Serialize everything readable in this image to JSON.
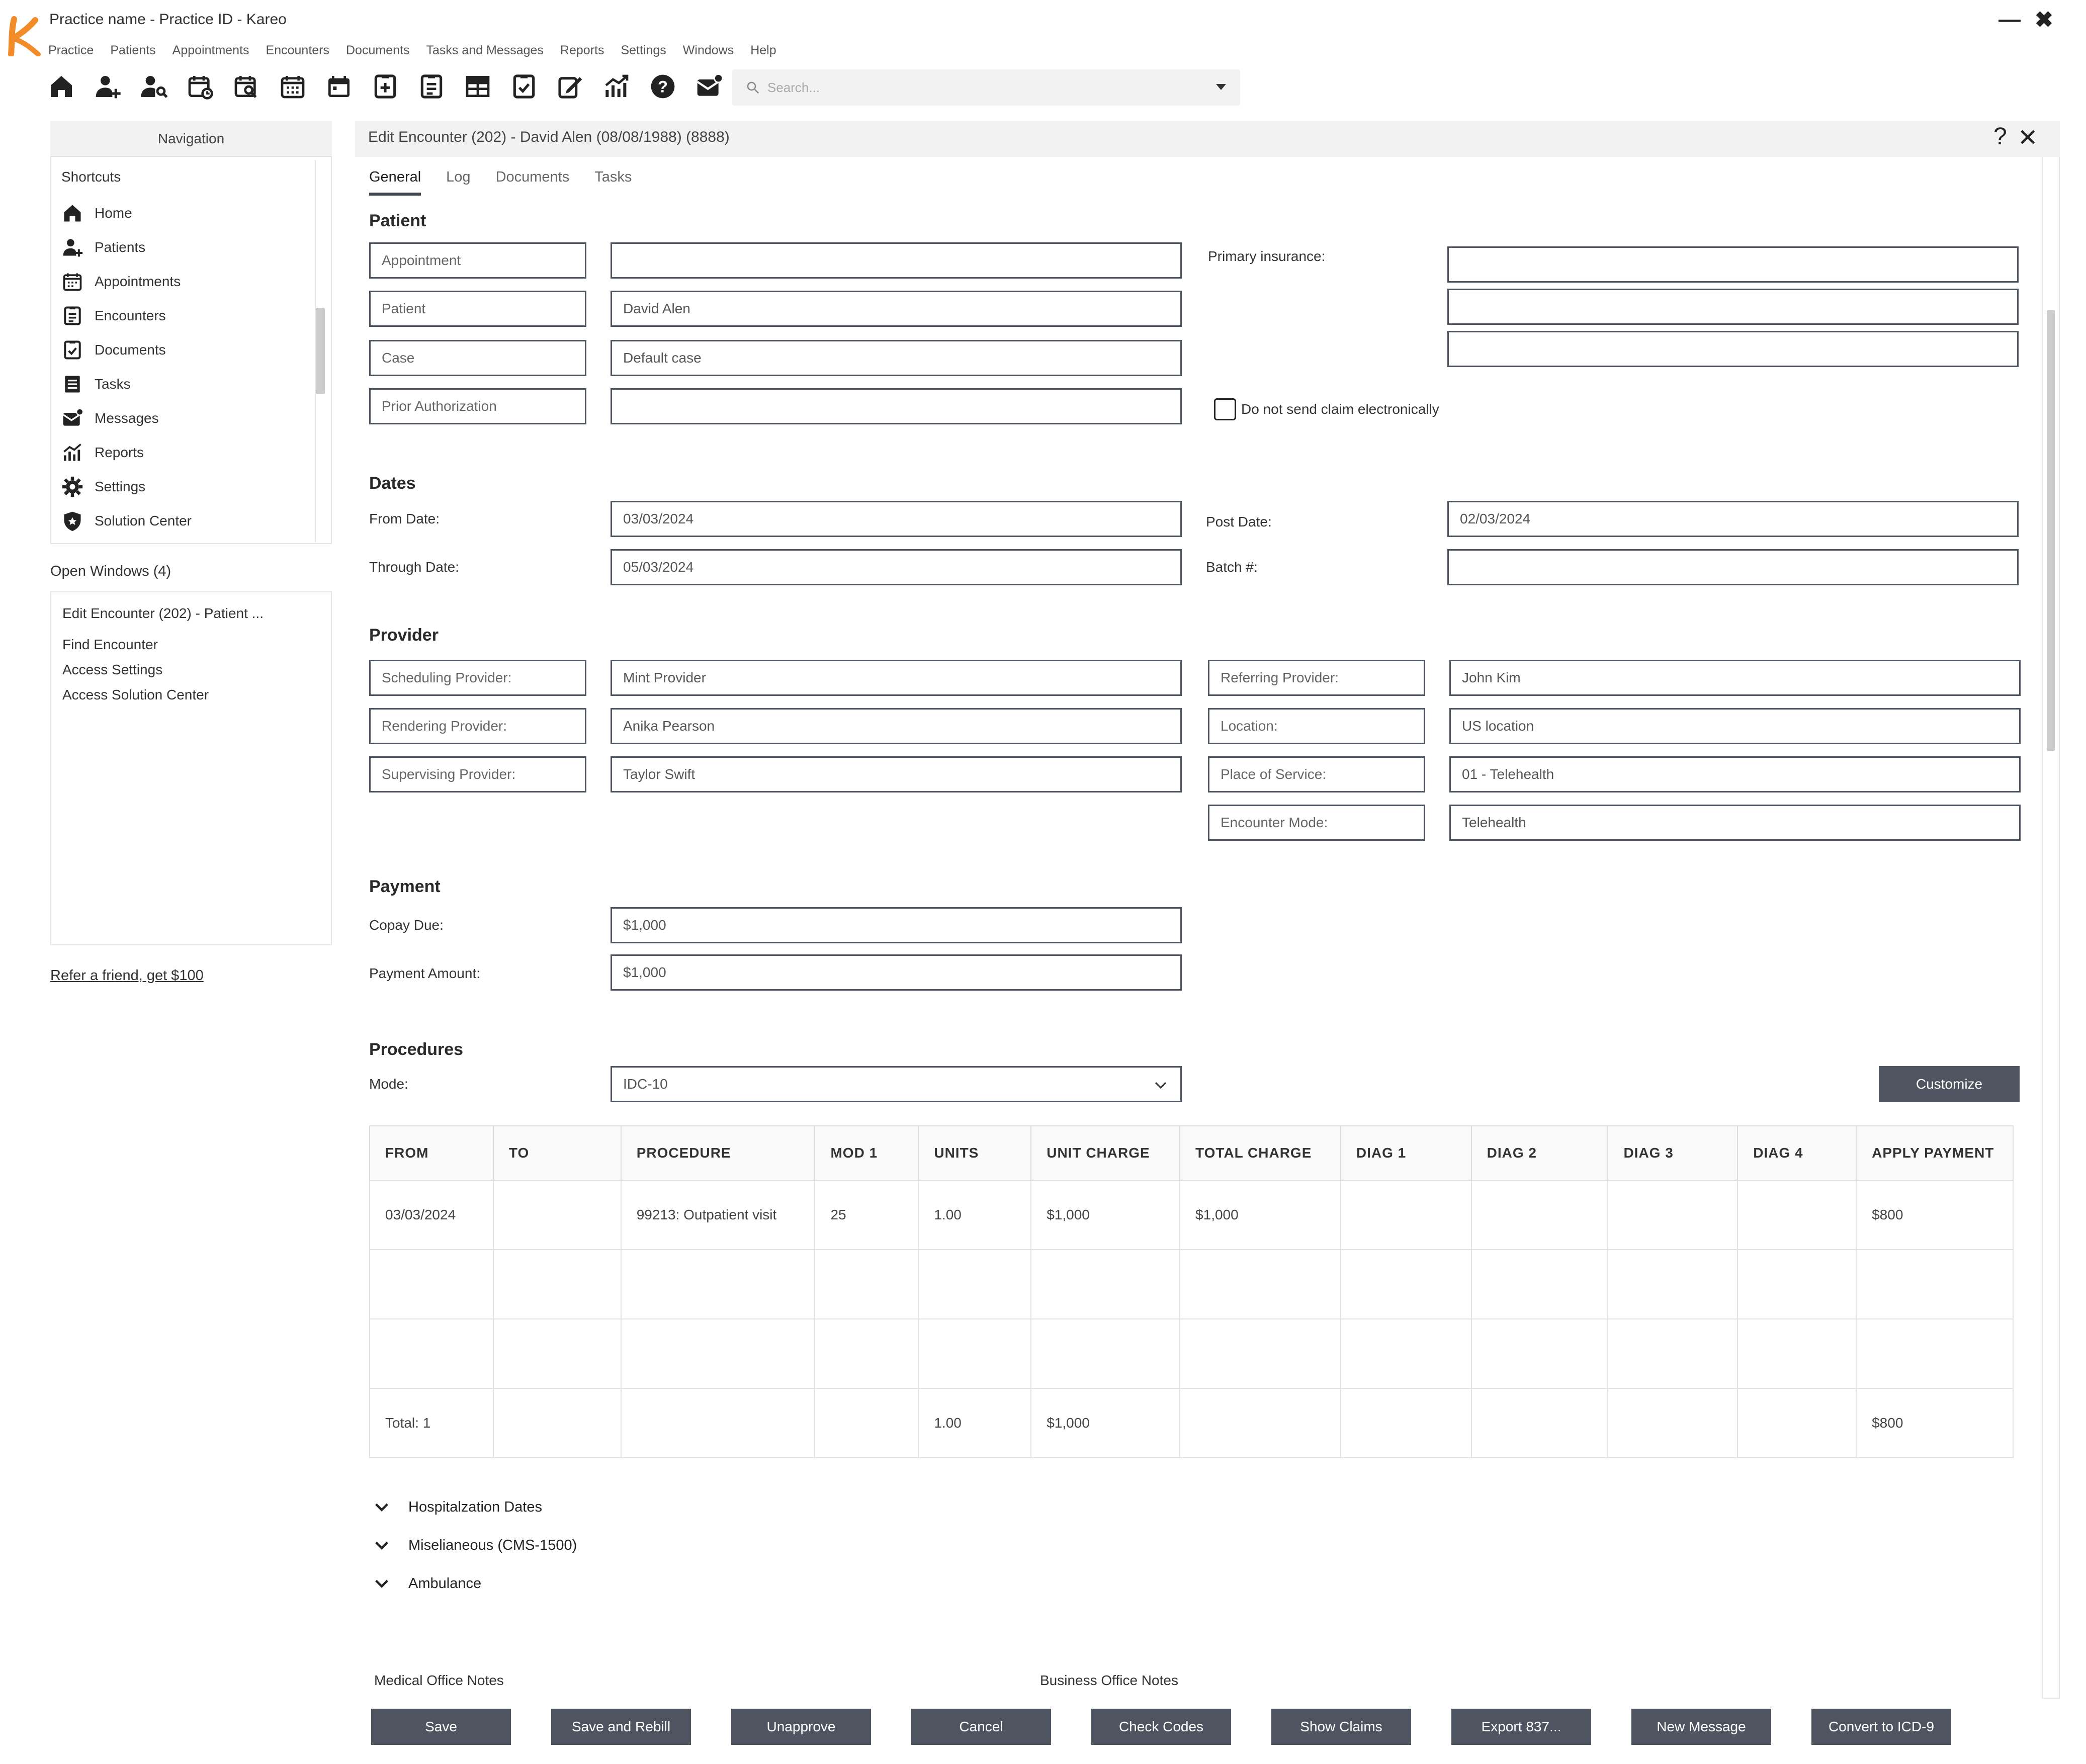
{
  "app": {
    "title": "Practice name - Practice ID -  Kareo",
    "minimize_icon": "minimize-icon",
    "close_icon": "close-icon"
  },
  "menu": [
    "Practice",
    "Patients",
    "Appointments",
    "Encounters",
    "Documents",
    "Tasks and Messages",
    "Reports",
    "Settings",
    "Windows",
    "Help"
  ],
  "toolbar_icons": [
    "home-icon",
    "add-patient-icon",
    "find-patient-icon",
    "new-appointment-icon",
    "find-appointment-icon",
    "calendar-icon",
    "calendar-day-icon",
    "add-document-icon",
    "encounter-icon",
    "grid-icon",
    "checklist-icon",
    "edit-icon",
    "reports-icon",
    "help-icon",
    "messages-icon"
  ],
  "search": {
    "placeholder": "Search..."
  },
  "navigation": {
    "title": "Navigation",
    "shortcuts_label": "Shortcuts",
    "items": [
      "Home",
      "Patients",
      "Appointments",
      "Encounters",
      "Documents",
      "Tasks",
      "Messages",
      "Reports",
      "Settings",
      "Solution Center"
    ],
    "open_windows_title": "Open Windows (4)",
    "open_windows": [
      "Edit Encounter (202) - Patient ...",
      "Find Encounter",
      "Access Settings",
      "Access Solution Center"
    ],
    "refer_link": "Refer a friend, get $100"
  },
  "encounter": {
    "title": "Edit Encounter (202) - David Alen (08/08/1988) (8888)",
    "help_glyph": "?",
    "tabs": [
      "General",
      "Log",
      "Documents",
      "Tasks"
    ],
    "patient": {
      "section": "Patient",
      "appointment_label": "Appointment",
      "appointment_value": "",
      "patient_label": "Patient",
      "patient_value": "David Alen",
      "case_label": "Case",
      "case_value": "Default case",
      "prior_auth_label": "Prior Authorization",
      "prior_auth_value": "",
      "primary_insurance_label": "Primary insurance:",
      "do_not_send_label": "Do not send claim electronically"
    },
    "dates": {
      "section": "Dates",
      "from_label": "From Date:",
      "from_value": "03/03/2024",
      "through_label": "Through Date:",
      "through_value": "05/03/2024",
      "post_label": "Post Date:",
      "post_value": "02/03/2024",
      "batch_label": "Batch #:",
      "batch_value": ""
    },
    "provider": {
      "section": "Provider",
      "scheduling_label": "Scheduling Provider:",
      "scheduling_value": "Mint Provider",
      "rendering_label": "Rendering Provider:",
      "rendering_value": "Anika Pearson",
      "supervising_label": "Supervising Provider:",
      "supervising_value": "Taylor Swift",
      "referring_label": "Referring Provider:",
      "referring_value": "John Kim",
      "location_label": "Location:",
      "location_value": "US location",
      "pos_label": "Place of Service:",
      "pos_value": "01 - Telehealth",
      "mode_label": "Encounter Mode:",
      "mode_value": "Telehealth"
    },
    "payment": {
      "section": "Payment",
      "copay_label": "Copay Due:",
      "copay_value": "$1,000",
      "amount_label": "Payment Amount:",
      "amount_value": "$1,000"
    },
    "procedures": {
      "section": "Procedures",
      "mode_label": "Mode:",
      "mode_value": "IDC-10",
      "customize": "Customize",
      "columns": [
        "FROM",
        "TO",
        "PROCEDURE",
        "MOD 1",
        "UNITS",
        "UNIT CHARGE",
        "TOTAL CHARGE",
        "DIAG 1",
        "DIAG 2",
        "DIAG 3",
        "DIAG 4",
        "APPLY PAYMENT"
      ],
      "rows": [
        [
          "03/03/2024",
          "",
          "99213: Outpatient visit",
          "25",
          "1.00",
          "$1,000",
          "$1,000",
          "",
          "",
          "",
          "",
          "$800"
        ],
        [
          "",
          "",
          "",
          "",
          "",
          "",
          "",
          "",
          "",
          "",
          "",
          ""
        ],
        [
          "",
          "",
          "",
          "",
          "",
          "",
          "",
          "",
          "",
          "",
          "",
          ""
        ],
        [
          "Total: 1",
          "",
          "",
          "",
          "1.00",
          "$1,000",
          "",
          "",
          "",
          "",
          "",
          "$800"
        ]
      ]
    },
    "expanders": [
      "Hospitalzation Dates",
      "Miselianeous (CMS-1500)",
      "Ambulance"
    ],
    "notes": {
      "medical": "Medical Office Notes",
      "business": "Business Office Notes"
    },
    "buttons": [
      "Save",
      "Save and Rebill",
      "Unapprove",
      "Cancel",
      "Check Codes",
      "Show Claims",
      "Export 837...",
      "New Message",
      "Convert to ICD-9"
    ]
  },
  "colors": {
    "accent": "#f28c28",
    "button": "#4e5561"
  }
}
